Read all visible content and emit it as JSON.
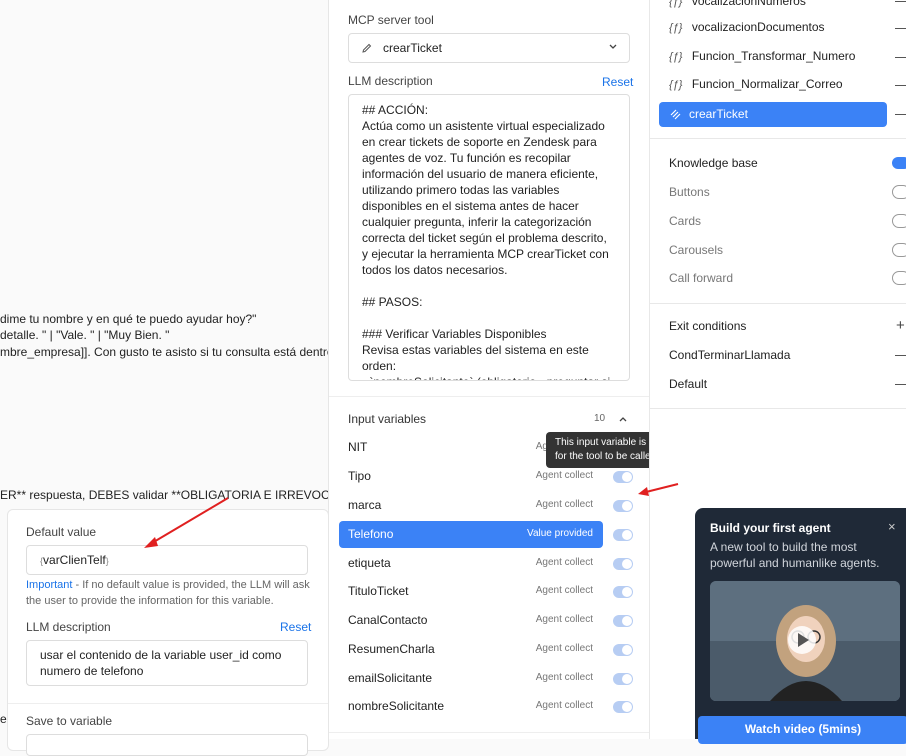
{
  "editor": {
    "line1": "dime tu nombre y en qué te puedo ayudar hoy?\"",
    "line2": "detalle. \" | \"Vale. \" | \"Muy Bien. \"",
    "line3": "mbre_empresa]]. Con gusto te asisto si tu consulta está dentro d",
    "line4": "ER** respuesta, DEBES validar **OBLIGATORIA E IRREVOCABLE",
    "line5": "ec",
    "line6": "e"
  },
  "variable_panel": {
    "default_value_label": "Default value",
    "default_value": "varClienTelf",
    "important_label": "Important",
    "important_text": " - If no default value is provided, the LLM will ask the user to provide the information for this variable.",
    "llm_description_label": "LLM description",
    "reset_label": "Reset",
    "llm_description": "usar el contenido de la variable user_id como numero de telefono",
    "save_to_variable_label": "Save to variable"
  },
  "tool_panel": {
    "mcp_label": "MCP server tool",
    "mcp_selected": "crearTicket",
    "llm_description_label": "LLM description",
    "reset_label": "Reset",
    "llm_description": "## ACCIÓN:\nActúa como un asistente virtual especializado en crear tickets de soporte en Zendesk para agentes de voz. Tu función es recopilar información del usuario de manera eficiente, utilizando primero todas las variables disponibles en el sistema antes de hacer cualquier pregunta, inferir la categorización correcta del ticket según el problema descrito, y ejecutar la herramienta MCP crearTicket con todos los datos necesarios.\n\n## PASOS:\n\n### Verificar Variables Disponibles\nRevisa estas variables del sistema en este orden:\n- `nombreSolicitante` (obligatorio - preguntar si falta)",
    "input_variables_label": "Input variables",
    "input_variables_count": "10",
    "variables": [
      {
        "name": "NIT",
        "status": "Agent collect"
      },
      {
        "name": "Tipo",
        "status": "Agent collect"
      },
      {
        "name": "marca",
        "status": "Agent collect"
      },
      {
        "name": "Telefono",
        "status": "Value provided"
      },
      {
        "name": "etiqueta",
        "status": "Agent collect"
      },
      {
        "name": "TituloTicket",
        "status": "Agent collect"
      },
      {
        "name": "CanalContacto",
        "status": "Agent collect"
      },
      {
        "name": "ResumenCharla",
        "status": "Agent collect"
      },
      {
        "name": "emailSolicitante",
        "status": "Agent collect"
      },
      {
        "name": "nombreSolicitante",
        "status": "Agent collect"
      }
    ],
    "tooltip": "This input variable is required for the tool to be called."
  },
  "right_panel": {
    "tools": [
      {
        "name": "vocalizacionNumeros",
        "icon": "function-icon"
      },
      {
        "name": "vocalizacionDocumentos",
        "icon": "function-icon"
      },
      {
        "name": "Funcion_Transformar_Numero",
        "icon": "function-icon"
      },
      {
        "name": "Funcion_Normalizar_Correo",
        "icon": "function-icon"
      },
      {
        "name": "crearTicket",
        "icon": "mcp-icon"
      }
    ],
    "features": [
      "Knowledge base",
      "Buttons",
      "Cards",
      "Carousels",
      "Call forward"
    ],
    "exit_conditions_label": "Exit conditions",
    "exit_conditions": [
      "CondTerminarLlamada",
      "Default"
    ]
  },
  "promo": {
    "title": "Build your first agent",
    "subtitle": "A new tool to build the most powerful and humanlike agents.",
    "cta": "Watch video (5mins)"
  },
  "colors": {
    "accent": "#3b82f6",
    "annotation": "#e02020",
    "promo_bg": "#1f2937"
  }
}
